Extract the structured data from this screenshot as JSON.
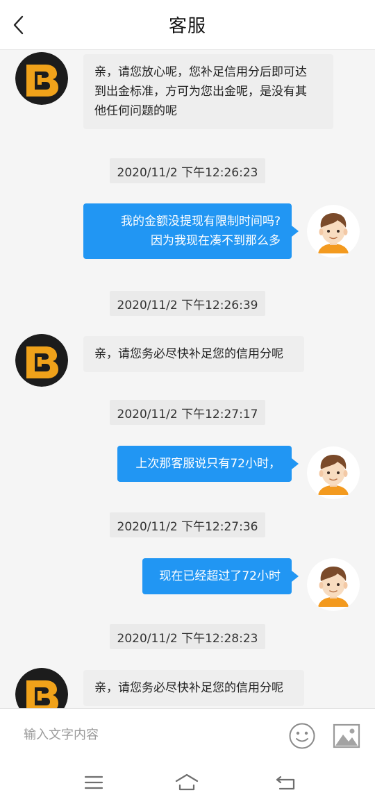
{
  "header": {
    "title": "客服"
  },
  "messages": {
    "m1": {
      "text": "亲，请您放心呢，您补足信用分后即可达\n到出金标准，方可为您出金呢，是没有其\n他任何问题的呢"
    },
    "t1": "2020/11/2 下午12:26:23",
    "m2": {
      "text": "我的金额没提现有限制时间吗?\n因为我现在凑不到那么多"
    },
    "t2": "2020/11/2 下午12:26:39",
    "m3": {
      "text": "亲，请您务必尽快补足您的信用分呢"
    },
    "t3": "2020/11/2 下午12:27:17",
    "m4": {
      "text": "上次那客服说只有72小时，"
    },
    "t4": "2020/11/2 下午12:27:36",
    "m5": {
      "text": "现在已经超过了72小时"
    },
    "t5": "2020/11/2 下午12:28:23",
    "m6": {
      "text": "亲，请您务必尽快补足您的信用分呢"
    }
  },
  "input": {
    "placeholder": "输入文字内容"
  },
  "icons": {
    "back": "chevron-left-icon",
    "emoji": "smiley-icon",
    "image": "image-icon",
    "menu": "menu-icon",
    "home": "home-icon",
    "return": "return-icon",
    "agent_avatar": "agent-logo-avatar",
    "user_avatar": "user-cartoon-avatar"
  },
  "colors": {
    "accent": "#2196f3",
    "incoming_bubble": "#eeeeee",
    "timestamp_bg": "#eaeaea",
    "agent_logo_bg": "#1c1c1c",
    "agent_logo_fg": "#f0a21a",
    "user_shirt": "#f39a1f"
  }
}
